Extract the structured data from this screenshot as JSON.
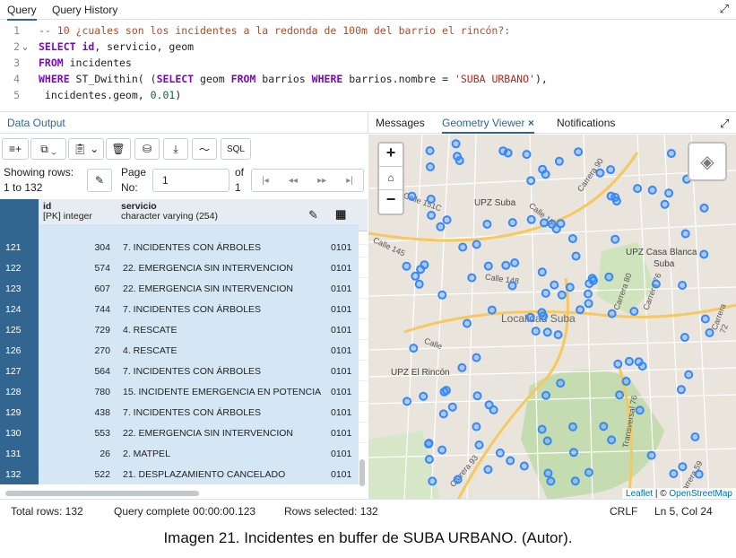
{
  "tabs": {
    "query": "Query",
    "query_history": "Query History"
  },
  "editor": {
    "lines": [
      {
        "n": "1",
        "parts": [
          {
            "t": "-- 10 ¿cuales son los incidentes a la redonda de 100m del barrio el rincón?:",
            "c": "cm"
          }
        ]
      },
      {
        "n": "2",
        "fold": "⌄",
        "parts": [
          {
            "t": "SELECT",
            "c": "kw"
          },
          {
            "t": " id",
            "c": "kw"
          },
          {
            "t": ", servicio, geom",
            "c": ""
          }
        ]
      },
      {
        "n": "3",
        "parts": [
          {
            "t": "FROM",
            "c": "kw"
          },
          {
            "t": " incidentes",
            "c": ""
          }
        ]
      },
      {
        "n": "4",
        "parts": [
          {
            "t": "WHERE",
            "c": "kw"
          },
          {
            "t": " ST_Dwithin( (",
            "c": ""
          },
          {
            "t": "SELECT",
            "c": "kw"
          },
          {
            "t": " geom ",
            "c": ""
          },
          {
            "t": "FROM",
            "c": "kw"
          },
          {
            "t": " barrios ",
            "c": ""
          },
          {
            "t": "WHERE",
            "c": "kw"
          },
          {
            "t": " barrios.nombre = ",
            "c": ""
          },
          {
            "t": "'SUBA URBANO'",
            "c": "str"
          },
          {
            "t": "),",
            "c": ""
          }
        ]
      },
      {
        "n": "5",
        "parts": [
          {
            "t": " incidentes.geom, ",
            "c": ""
          },
          {
            "t": "0.01",
            "c": "num"
          },
          {
            "t": ")",
            "c": ""
          }
        ]
      }
    ]
  },
  "panels": {
    "data_output": "Data Output",
    "messages": "Messages",
    "geometry_viewer": "Geometry Viewer",
    "notifications": "Notifications"
  },
  "toolbar": {
    "sql": "SQL"
  },
  "pagination": {
    "showing": "Showing rows:",
    "range": "1 to 132",
    "page_label": "Page",
    "no_label": "No:",
    "page": "1",
    "of": "of",
    "total_pages": "1"
  },
  "columns": {
    "id_name": "id",
    "id_type": "[PK] integer",
    "servicio_name": "servicio",
    "servicio_type": "character varying (254)"
  },
  "rows": [
    {
      "n": "121",
      "id": "304",
      "servicio": "7. INCIDENTES CON ÁRBOLES",
      "geom": "0101"
    },
    {
      "n": "122",
      "id": "574",
      "servicio": "22. EMERGENCIA SIN INTERVENCION",
      "geom": "0101"
    },
    {
      "n": "123",
      "id": "607",
      "servicio": "22. EMERGENCIA SIN INTERVENCION",
      "geom": "0101"
    },
    {
      "n": "124",
      "id": "744",
      "servicio": "7. INCIDENTES CON ÁRBOLES",
      "geom": "0101"
    },
    {
      "n": "125",
      "id": "729",
      "servicio": "4. RESCATE",
      "geom": "0101"
    },
    {
      "n": "126",
      "id": "270",
      "servicio": "4. RESCATE",
      "geom": "0101"
    },
    {
      "n": "127",
      "id": "564",
      "servicio": "7. INCIDENTES CON ÁRBOLES",
      "geom": "0101"
    },
    {
      "n": "128",
      "id": "780",
      "servicio": "15. INCIDENTE EMERGENCIA EN POTENCIA",
      "geom": "0101"
    },
    {
      "n": "129",
      "id": "438",
      "servicio": "7. INCIDENTES CON ÁRBOLES",
      "geom": "0101"
    },
    {
      "n": "130",
      "id": "553",
      "servicio": "22. EMERGENCIA SIN INTERVENCION",
      "geom": "0101"
    },
    {
      "n": "131",
      "id": "26",
      "servicio": "2. MATPEL",
      "geom": "0101"
    },
    {
      "n": "132",
      "id": "522",
      "servicio": "21. DESPLAZAMIENTO CANCELADO",
      "geom": "0101"
    }
  ],
  "map": {
    "labels": {
      "upz_suba": "UPZ Suba",
      "upz_casa_blanca": "UPZ Casa Blanca",
      "suba": "Suba",
      "localidad": "Localidad Suba",
      "upz_rincon": "UPZ El Rincón",
      "calle148": "Calle 148",
      "calle145": "Calle 145",
      "calle151c": "Calle 151C",
      "calle154": "Calle 154",
      "carrera90": "Carrera 90",
      "carrera80": "Carrera 80",
      "carrera76": "Carrera 76",
      "carrera72": "Carrera 72",
      "carrera93": "Carrera 93",
      "carrera59": "Carrera 59",
      "calle": "Calle",
      "transversal": "Transversal 76"
    },
    "attribution": {
      "leaflet": "Leaflet",
      "sep": " | © ",
      "osm": "OpenStreetMap"
    },
    "zoom_in": "+",
    "zoom_out": "−",
    "marker_color": "#3388ff"
  },
  "status": {
    "total_rows": "Total rows: 132",
    "query_complete": "Query complete 00:00:00.123",
    "rows_selected": "Rows selected: 132",
    "crlf": "CRLF",
    "position": "Ln 5, Col 24"
  },
  "caption": "Imagen 21. Incidentes en buffer de SUBA URBANO. (Autor)."
}
